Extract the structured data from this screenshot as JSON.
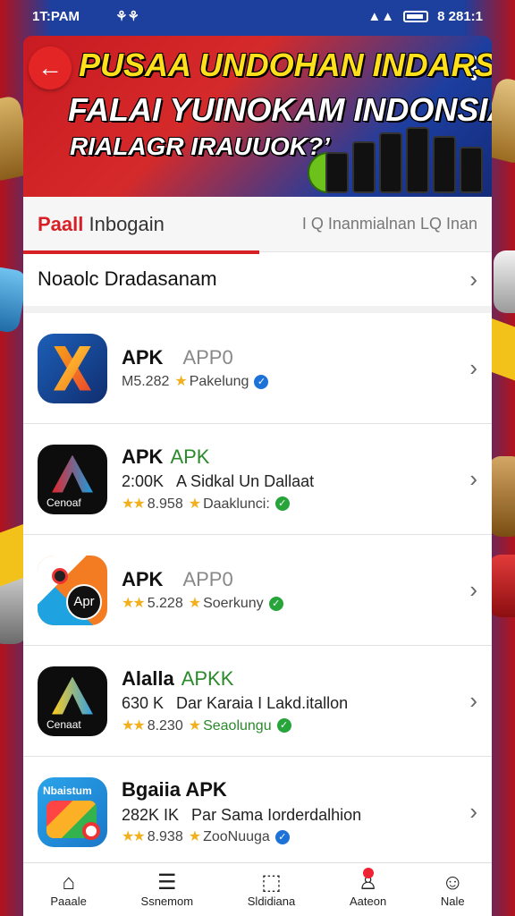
{
  "status_bar": {
    "time": "1T:PAM",
    "left_icon": "⚘⚘",
    "right_text": "8 281:1"
  },
  "banner": {
    "line1": "PUSAA UNDOHAN INDARSIA",
    "line2": "FALAI YUINOKAM INDONSIA",
    "line3": "RIALAGR IRAUUOK?’"
  },
  "tabs": {
    "active_accent": "Paall",
    "active_rest": " Inbogain",
    "right": "I Q Inanmialnan LQ Inan"
  },
  "section": {
    "title": "Noaolc Dradasanam"
  },
  "apps": [
    {
      "title": "APK",
      "tag": "APP0",
      "sub_left": "",
      "sub_right": "",
      "rating": "M5.282",
      "developer": "Pakelung",
      "verified": "blue",
      "icon": "x-icon"
    },
    {
      "title": "APK",
      "tag": "APK",
      "sub_left": "2:00K",
      "sub_right": "A Sidkal Un Dallaat",
      "rating": "8.958",
      "developer": "Daaklunci:",
      "verified": "green",
      "icon": "a-icon",
      "icon_label": "Cenoaf"
    },
    {
      "title": "APK",
      "tag": "APP0",
      "sub_left": "",
      "sub_right": "",
      "rating": "5.228",
      "developer": "Soerkuny",
      "verified": "green",
      "icon": "camera-icon",
      "icon_label": "Apr"
    },
    {
      "title": "Alalla",
      "tag": "APKK",
      "sub_left": "630 K",
      "sub_right": "Dar Karaia I Lakd.itallon",
      "rating": "8.230",
      "developer": "Seaolungu",
      "verified": "green",
      "icon": "a-icon",
      "icon_label": "Cenaat"
    },
    {
      "title": "Bgaiia APK",
      "tag": "",
      "sub_left": "282K IK",
      "sub_right": "Par Sama Iorderdalhion",
      "rating": "8.938",
      "developer": "ZooNuuga",
      "verified": "blue",
      "icon": "maps-icon",
      "icon_label": "Nbaistum"
    }
  ],
  "nav": [
    {
      "label": "Paaale",
      "icon": "home-icon"
    },
    {
      "label": "Ssnemom",
      "icon": "list-icon"
    },
    {
      "label": "Sldidiana",
      "icon": "box-icon"
    },
    {
      "label": "Aateon",
      "icon": "user-alert-icon"
    },
    {
      "label": "Nale",
      "icon": "profile-icon"
    }
  ]
}
